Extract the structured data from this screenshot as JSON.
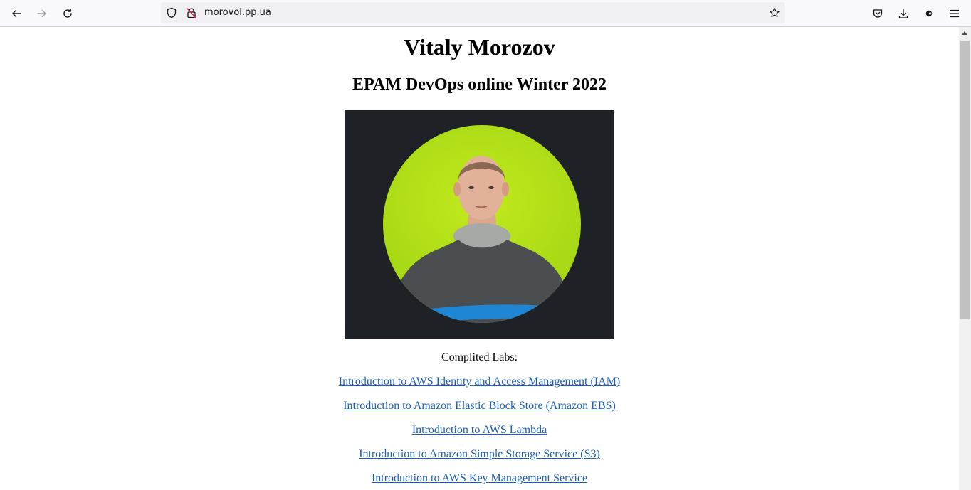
{
  "browser": {
    "url": "morovol.pp.ua",
    "icons": {
      "back": "back-arrow-icon",
      "forward": "forward-arrow-icon",
      "reload": "reload-icon",
      "tracking": "shield-icon",
      "connection": "insecure-lock-icon",
      "bookmark": "star-icon",
      "pocket": "pocket-icon",
      "downloads": "download-icon",
      "extensions": "extension-icon",
      "menu": "hamburger-menu-icon"
    }
  },
  "page": {
    "name": "Vitaly Morozov",
    "subtitle": "EPAM DevOps online Winter 2022",
    "labs_heading": "Complited Labs:",
    "labs": [
      "Introduction to AWS Identity and Access Management (IAM)",
      "Introduction to Amazon Elastic Block Store (Amazon EBS)",
      "Introduction to AWS Lambda",
      "Introduction to Amazon Simple Storage Service (S3)",
      "Introduction to AWS Key Management Service"
    ]
  },
  "colors": {
    "link": "#1a5fb4",
    "photo_background": "#1e2227",
    "photo_circle": "#a8d916"
  }
}
